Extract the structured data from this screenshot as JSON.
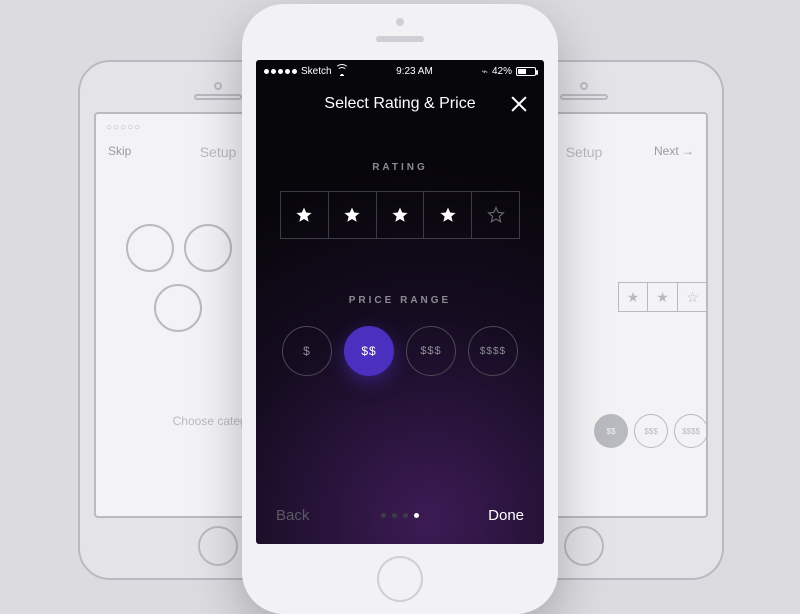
{
  "statusbar": {
    "carrier": "Sketch",
    "time": "9:23 AM",
    "battery_pct": "42%"
  },
  "header": {
    "title": "Select Rating & Price"
  },
  "rating": {
    "label": "RATING",
    "stars_total": 5,
    "stars_filled": 4
  },
  "price": {
    "label": "PRICE RANGE",
    "options": [
      "$",
      "$$",
      "$$$",
      "$$$$"
    ],
    "selected_index": 1
  },
  "footer": {
    "back": "Back",
    "done": "Done",
    "page_count": 4,
    "page_active": 3
  },
  "wireframe": {
    "skip": "Skip",
    "next": "Next →",
    "title": "Setup",
    "choose": "Choose category",
    "status_dots": "○○○○○"
  },
  "colors": {
    "accent": "#4b2fbf"
  }
}
